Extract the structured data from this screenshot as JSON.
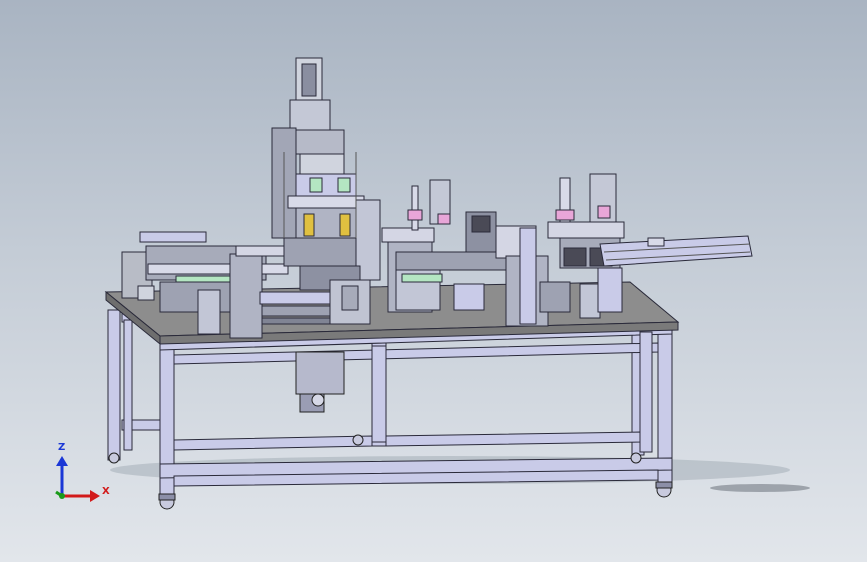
{
  "viewport": {
    "background_top": "#a9b4c2",
    "background_bottom": "#e2e6eb"
  },
  "model": {
    "frame_color": "#c9cbe8",
    "frame_edge": "#2a2a3a",
    "tabletop_color": "#8d8d8d",
    "steel_color": "#b8bcc6",
    "accent_colors": [
      "#b4e6c2",
      "#e8a6d8",
      "#e0c040"
    ]
  },
  "triad": {
    "z_label": "Z",
    "x_label": "X",
    "z_color": "#1a37d6",
    "x_color": "#d21a1a",
    "y_color": "#1a9a1a"
  }
}
